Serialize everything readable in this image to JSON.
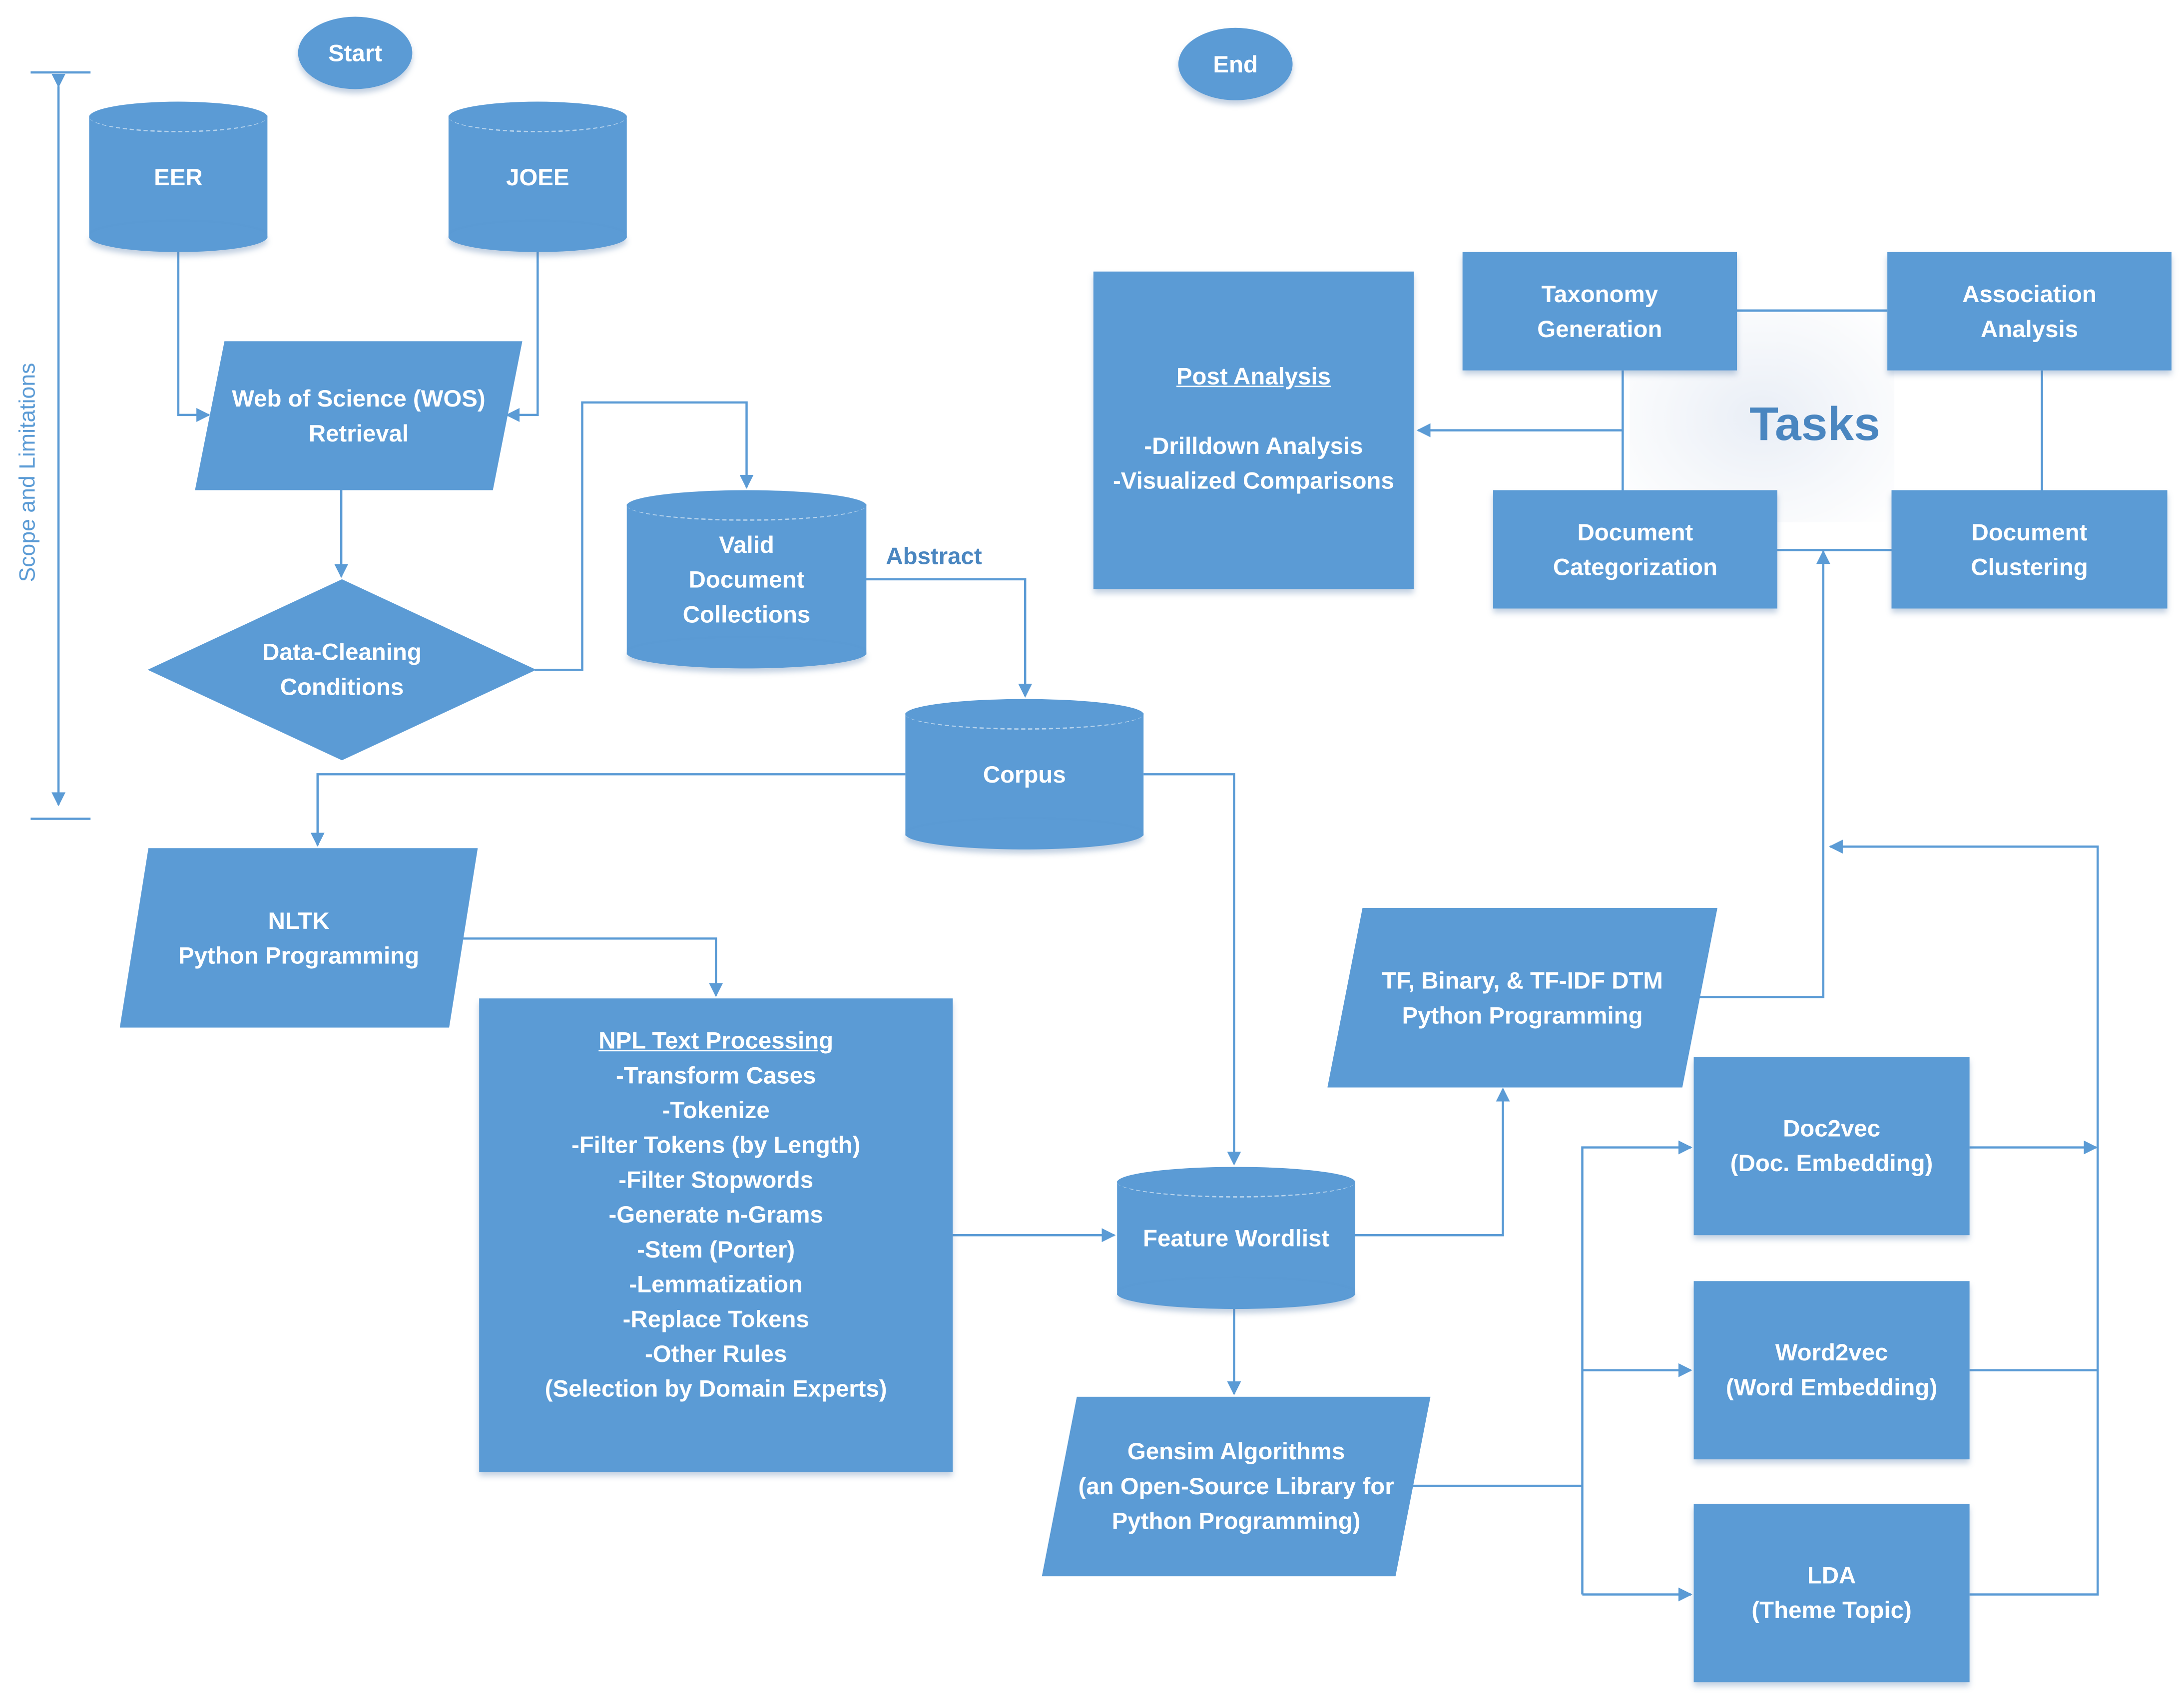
{
  "diagram": {
    "accent_color": "#5b9bd5",
    "label_color": "#4a86c0",
    "scope_label": "Scope and Limitations",
    "tasks_title": "Tasks",
    "edge_labels": {
      "abstract": "Abstract"
    },
    "nodes": {
      "start": {
        "shape": "ellipse",
        "lines": [
          "Start"
        ]
      },
      "end": {
        "shape": "ellipse",
        "lines": [
          "End"
        ]
      },
      "eer": {
        "shape": "cylinder",
        "lines": [
          "EER"
        ]
      },
      "joee": {
        "shape": "cylinder",
        "lines": [
          "JOEE"
        ]
      },
      "wos": {
        "shape": "parallelogram",
        "lines": [
          "Web of Science (WOS)",
          "Retrieval"
        ]
      },
      "cleaning": {
        "shape": "diamond",
        "lines": [
          "Data-Cleaning",
          "Conditions"
        ]
      },
      "valid_docs": {
        "shape": "cylinder",
        "lines": [
          "Valid",
          "Document",
          "Collections"
        ]
      },
      "corpus": {
        "shape": "cylinder",
        "lines": [
          "Corpus"
        ]
      },
      "nltk": {
        "shape": "parallelogram",
        "lines": [
          "NLTK",
          "Python Programming"
        ]
      },
      "npl": {
        "shape": "rectangle",
        "title": "NPL Text Processing",
        "lines": [
          "-Transform Cases",
          "-Tokenize",
          "-Filter Tokens (by Length)",
          "-Filter Stopwords",
          "-Generate n-Grams",
          "-Stem (Porter)",
          "-Lemmatization",
          "-Replace Tokens",
          "-Other Rules",
          "(Selection by Domain Experts)"
        ]
      },
      "feature_wordlist": {
        "shape": "cylinder",
        "lines": [
          "Feature Wordlist"
        ]
      },
      "dtm": {
        "shape": "parallelogram",
        "lines": [
          "TF, Binary, & TF-IDF DTM",
          "Python Programming"
        ]
      },
      "gensim": {
        "shape": "parallelogram",
        "lines": [
          "Gensim  Algorithms",
          "(an Open-Source Library for",
          "Python Programming)"
        ]
      },
      "doc2vec": {
        "shape": "rectangle",
        "lines": [
          "Doc2vec",
          "(Doc. Embedding)"
        ]
      },
      "word2vec": {
        "shape": "rectangle",
        "lines": [
          "Word2vec",
          "(Word Embedding)"
        ]
      },
      "lda": {
        "shape": "rectangle",
        "lines": [
          "LDA",
          "(Theme Topic)"
        ]
      },
      "post_analysis": {
        "shape": "rectangle",
        "title": "Post Analysis",
        "lines": [
          "",
          "-Drilldown Analysis",
          "-Visualized Comparisons"
        ]
      },
      "taxonomy": {
        "shape": "rectangle",
        "lines": [
          "Taxonomy",
          "Generation"
        ]
      },
      "association": {
        "shape": "rectangle",
        "lines": [
          "Association",
          "Analysis"
        ]
      },
      "categorization": {
        "shape": "rectangle",
        "lines": [
          "Document",
          "Categorization"
        ]
      },
      "clustering": {
        "shape": "rectangle",
        "lines": [
          "Document",
          "Clustering"
        ]
      }
    }
  }
}
